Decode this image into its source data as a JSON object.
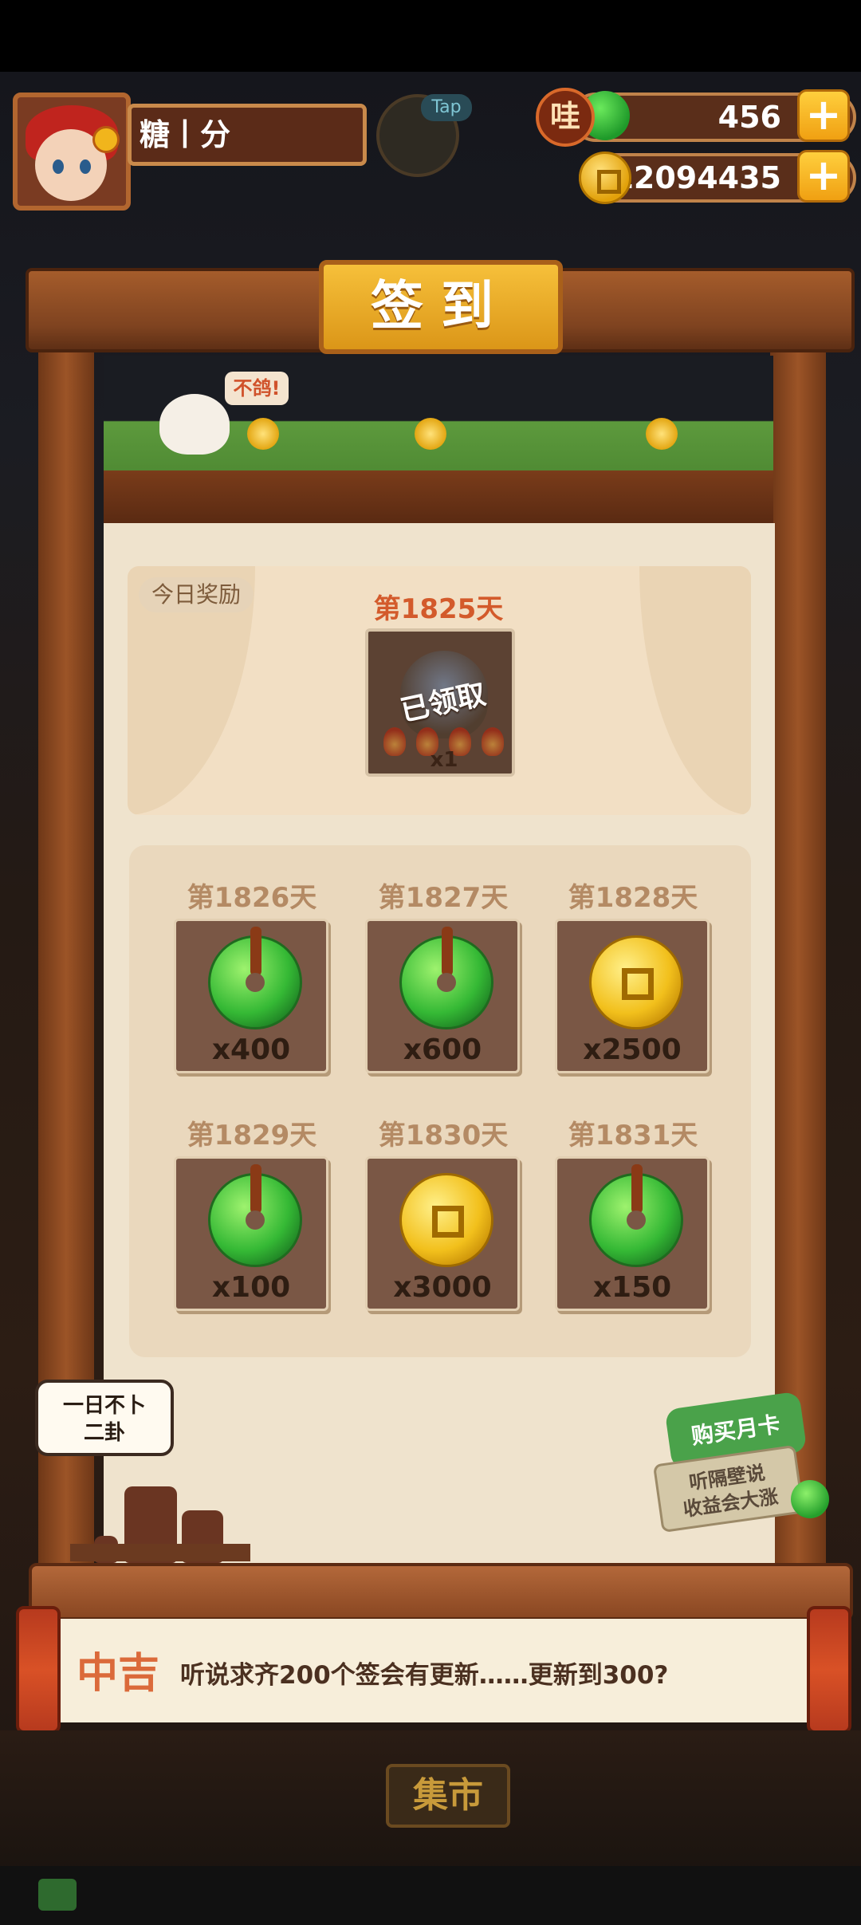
{
  "player": {
    "name": "糖丨分",
    "tap_label": "Tap"
  },
  "currency": {
    "wa_label": "哇",
    "jade_amount": "456",
    "coin_amount": "12094435"
  },
  "popup": {
    "title": "签到",
    "roof_bubble": "不鸽!",
    "today_tag": "今日奖励",
    "today_day": "第1825天",
    "today_status": "已领取",
    "today_qty": "x1",
    "rewards": [
      {
        "day": "第1826天",
        "item": "jade",
        "qty": "x400"
      },
      {
        "day": "第1827天",
        "item": "jade",
        "qty": "x600"
      },
      {
        "day": "第1828天",
        "item": "coin",
        "qty": "x2500"
      },
      {
        "day": "第1829天",
        "item": "jade",
        "qty": "x100"
      },
      {
        "day": "第1830天",
        "item": "coin",
        "qty": "x3000"
      },
      {
        "day": "第1831天",
        "item": "jade",
        "qty": "x150"
      }
    ],
    "speech_line1": "一日不卜",
    "speech_line2": "二卦",
    "monthly_card": "购买月卡",
    "monthly_line1": "听隔壁说",
    "monthly_line2": "收益会大涨",
    "fortune_level": "中吉",
    "fortune_text": "听说求齐200个签会有更新……更新到300?"
  },
  "scene": {
    "market_sign": "集市"
  },
  "colors": {
    "accent_gold": "#f6c03a",
    "fortune_red": "#db6a3a",
    "jade_green": "#35b935"
  }
}
